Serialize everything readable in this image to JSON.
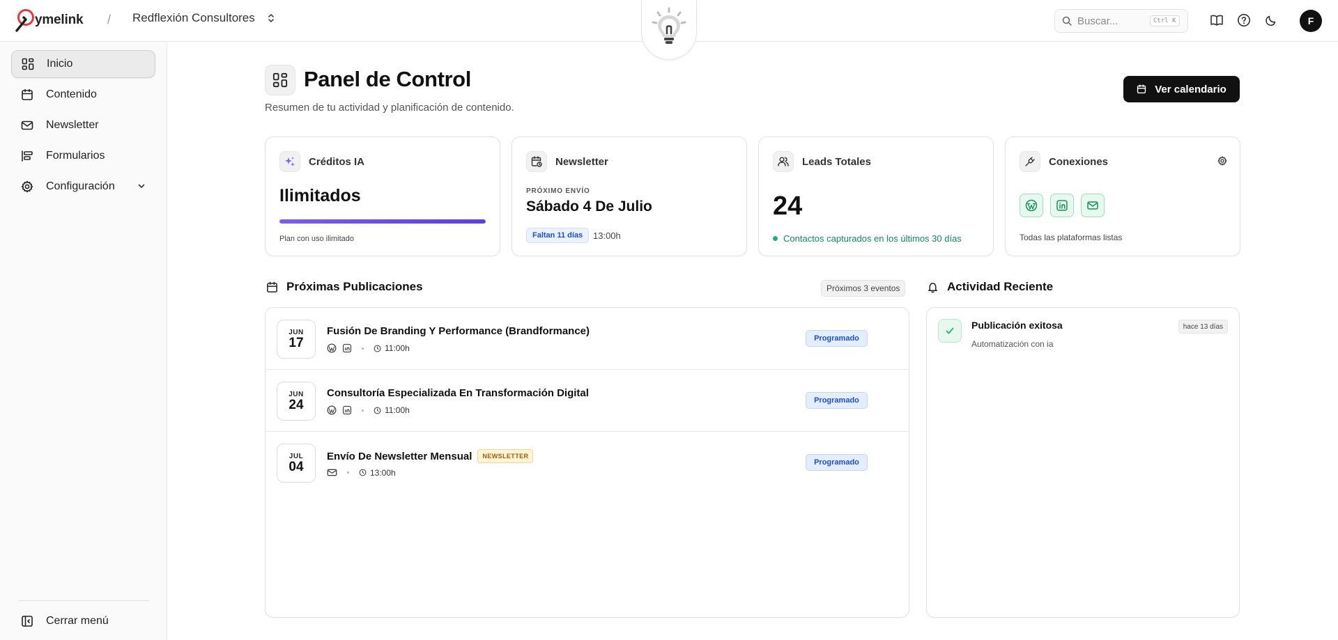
{
  "brand": {
    "name": "ymelink"
  },
  "breadcrumb": {
    "separator": "/",
    "organization": "Redflexión Consultores"
  },
  "search": {
    "placeholder": "Buscar...",
    "shortcut": "Ctrl K"
  },
  "user": {
    "initial": "F"
  },
  "sidebar": {
    "items": [
      {
        "label": "Inicio",
        "icon": "grid-icon",
        "active": true
      },
      {
        "label": "Contenido",
        "icon": "calendar-icon"
      },
      {
        "label": "Newsletter",
        "icon": "mail-icon"
      },
      {
        "label": "Formularios",
        "icon": "form-icon"
      },
      {
        "label": "Configuración",
        "icon": "gear-icon",
        "expandable": true
      }
    ],
    "collapse_label": "Cerrar menú"
  },
  "page": {
    "title": "Panel de Control",
    "subtitle": "Resumen de tu actividad y planificación de contenido.",
    "calendar_button": "Ver calendario"
  },
  "cards": {
    "ia": {
      "label": "Créditos IA",
      "value": "Ilimitados",
      "progress": 1.0,
      "note": "Plan con uso ilimitado"
    },
    "newsletter": {
      "label": "Newsletter",
      "kicker": "PRÓXIMO ENVÍO",
      "date": "Sábado 4 De Julio",
      "badge": "Faltan 11 días",
      "time": "13:00h"
    },
    "leads": {
      "label": "Leads Totales",
      "value": "24",
      "note": "Contactos capturados en los últimos 30 días"
    },
    "connections": {
      "label": "Conexiones",
      "platforms": [
        "wordpress-icon",
        "linkedin-icon",
        "mail-icon"
      ],
      "note": "Todas las plataformas listas"
    }
  },
  "upcoming": {
    "title": "Próximas Publicaciones",
    "count_label": "Próximos 3 eventos",
    "items": [
      {
        "month": "JUN",
        "day": "17",
        "title": "Fusión De Branding Y Performance (Brandformance)",
        "time": "11:00h",
        "status": "Programado"
      },
      {
        "month": "JUN",
        "day": "24",
        "title": "Consultoría Especializada En Transformación Digital",
        "time": "11:00h",
        "status": "Programado"
      },
      {
        "month": "JUL",
        "day": "04",
        "title": "Envío De Newsletter Mensual",
        "tag": "NEWSLETTER",
        "time": "13:00h",
        "status": "Programado"
      }
    ]
  },
  "activity": {
    "title": "Actividad Reciente",
    "items": [
      {
        "title": "Publicación exitosa",
        "subtitle": "Automatización con ia",
        "time": "hace 13 días"
      }
    ]
  },
  "colors": {
    "accent": "#6d4ff0",
    "success": "#19b47a",
    "info": "#1d4ed8",
    "warning": "#a15c07"
  }
}
